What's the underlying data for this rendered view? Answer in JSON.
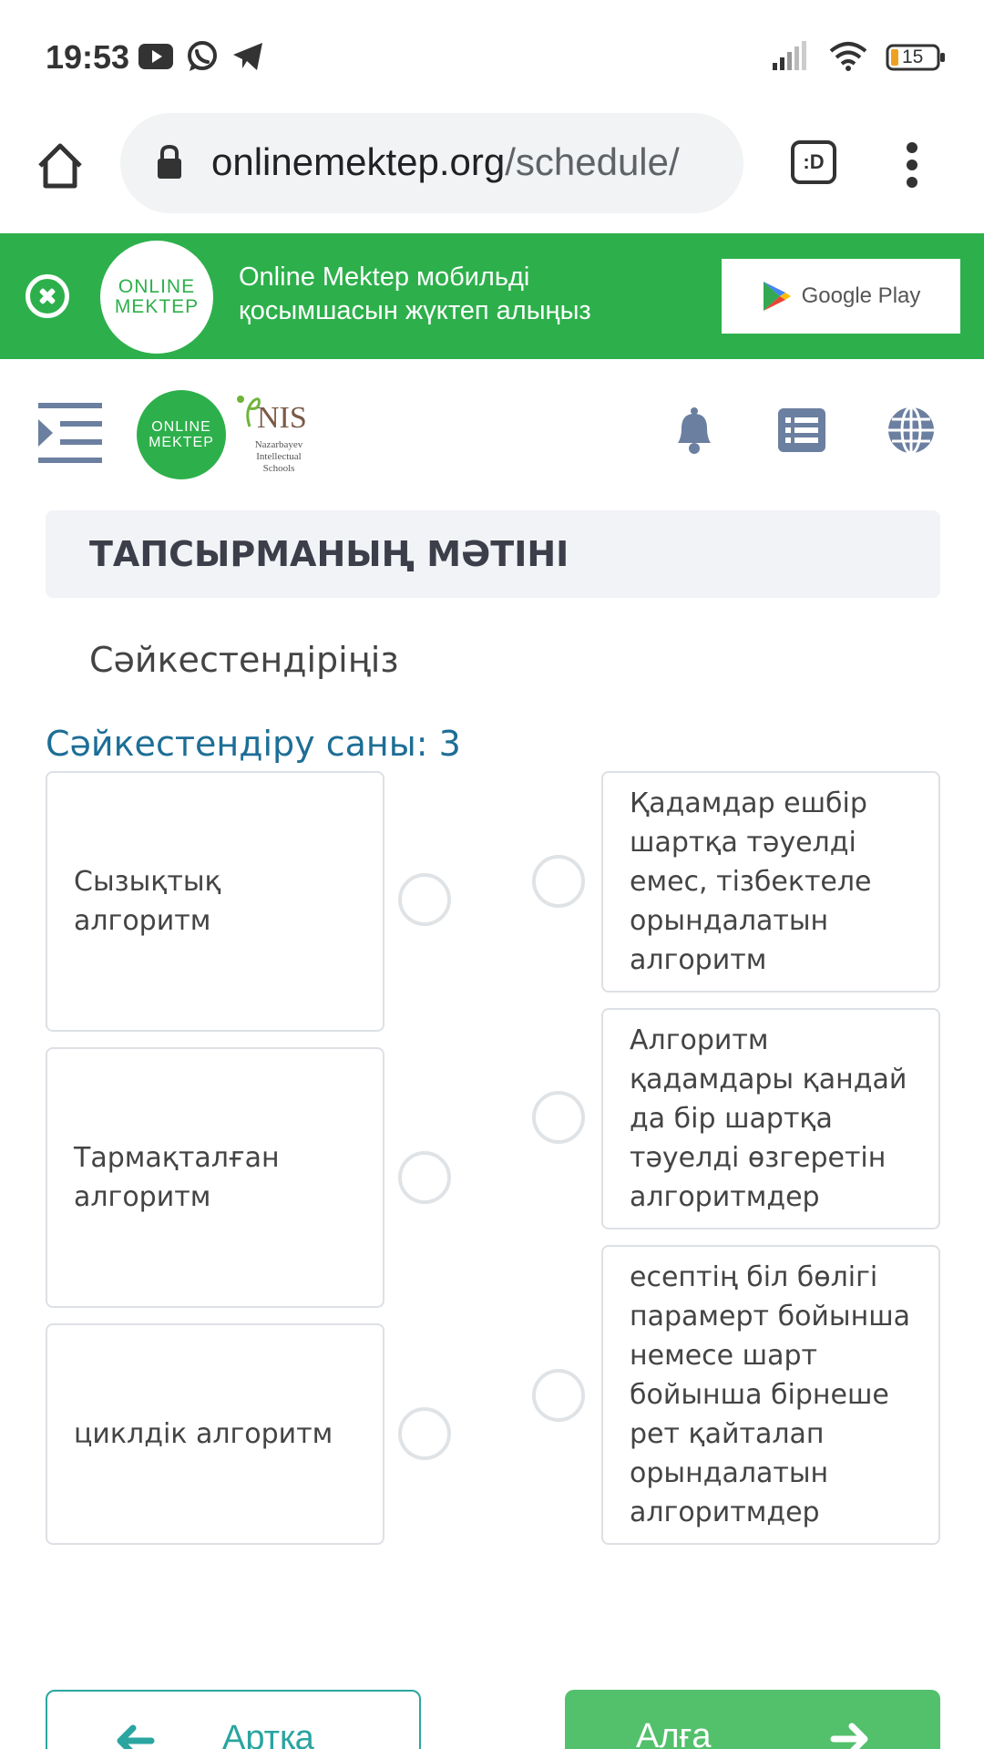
{
  "status_bar": {
    "time": "19:53",
    "battery": "15",
    "left_icons": [
      "youtube-icon",
      "whatsapp-icon",
      "telegram-icon"
    ],
    "right_icons": [
      "signal-icon",
      "wifi-icon",
      "battery-icon"
    ]
  },
  "browser": {
    "url_host": "onlinemektep.org",
    "url_path": "/schedule/",
    "tab_label": ":D"
  },
  "banner": {
    "logo_line1": "ONLINE",
    "logo_line2": "MEKTEP",
    "text_line1": "Online Mektep мобильді",
    "text_line2": "қосымшасын жүктеп алыңыз",
    "store_label": "Google Play"
  },
  "header": {
    "logo_line1": "ONLINE",
    "logo_line2": "MEKTEP",
    "nis_word": "NIS",
    "nis_sub": "Nazarbayev Intellectual Schools"
  },
  "task": {
    "section_title": "ТАПСЫРМАНЫҢ МӘТІНІ",
    "instruction": "Сәйкестендіріңіз",
    "match_count": "Сәйкестендіру саны: 3",
    "left_items": [
      "Сызықтық алгоритм",
      "Тармақталған алгоритм",
      "циклдік алгоритм"
    ],
    "right_items": [
      "Қадамдар ешбір шартқа тәуелді емес, тізбектеле орындалатын алгоритм",
      "Алгоритм қадамдары қандай да бір шартқа тәуелді өзгеретін алгоритмдер",
      "есептің біл бөлігі парамерт бойынша немесе шарт бойынша бірнеше рет қайталап орындалатын алгоритмдер"
    ]
  },
  "nav": {
    "back_label": "Артқа",
    "next_label": "Алға"
  },
  "colors": {
    "brand_green": "#2db04b",
    "match_blue": "#1d6e96",
    "back_teal": "#2aa5a0",
    "next_green": "#53c06c"
  }
}
